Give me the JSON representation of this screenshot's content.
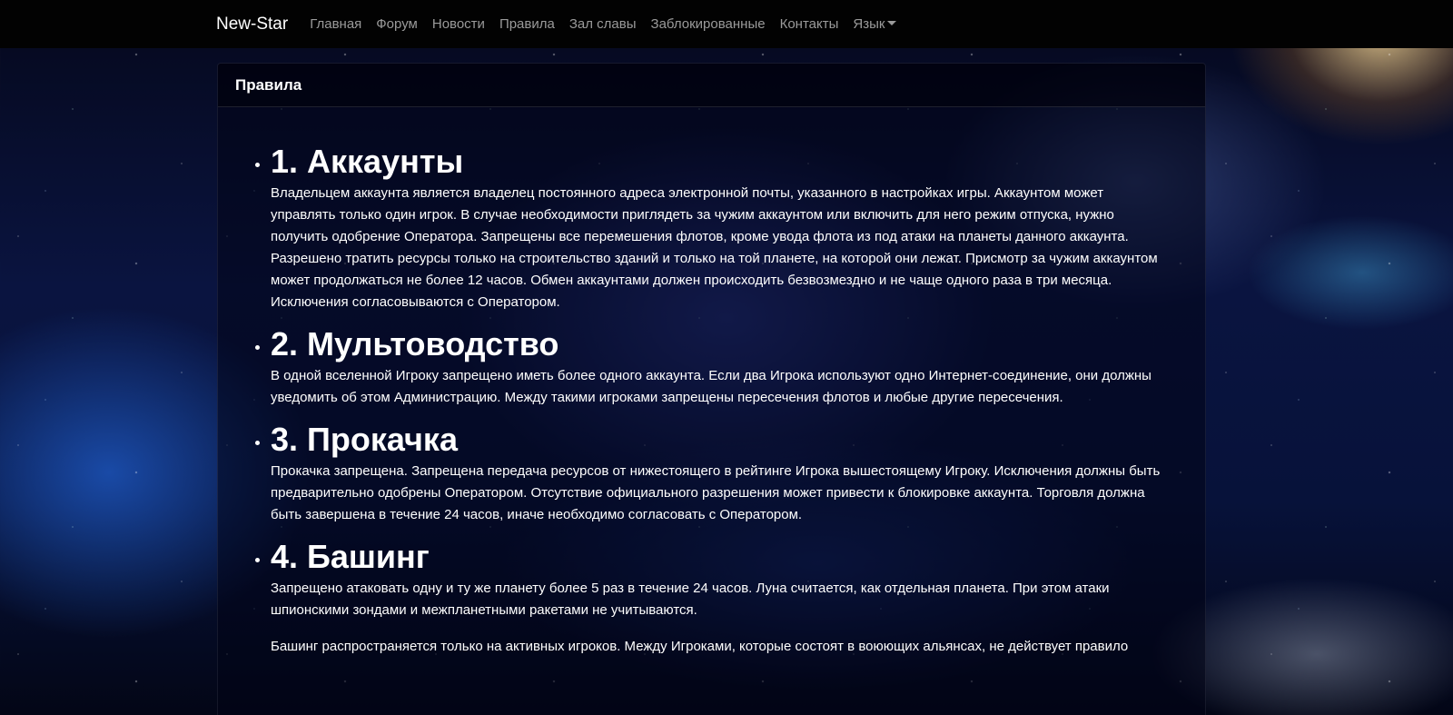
{
  "navbar": {
    "brand": "New-Star",
    "links": [
      "Главная",
      "Форум",
      "Новости",
      "Правила",
      "Зал славы",
      "Заблокированные",
      "Контакты"
    ],
    "language_label": "Язык"
  },
  "card": {
    "title": "Правила"
  },
  "rules": [
    {
      "title": "1. Аккаунты",
      "paragraphs": [
        "Владельцем аккаунта является владелец постоянного адреса электронной почты, указанного в настройках игры. Аккаунтом может управлять только один игрок. В случае необходимости приглядеть за чужим аккаунтом или включить для него режим отпуска, нужно получить одобрение Оператора. Запрещены все перемешения флотов, кроме увода флота из под атаки на планеты данного аккаунта. Разрешено тратить ресурсы только на строительство зданий и только на той планете, на которой они лежат. Присмотр за чужим аккаунтом может продолжаться не более 12 часов. Обмен аккаунтами должен происходить безвозмездно и не чаще одного раза в три месяца. Исключения согласовываются с Оператором."
      ]
    },
    {
      "title": "2. Мультоводство",
      "paragraphs": [
        "В одной вселенной Игроку запрещено иметь более одного аккаунта. Если два Игрока используют одно Интернет-соединение, они должны уведомить об этом Администрацию. Между такими игроками запрещены пересечения флотов и любые другие пересечения."
      ]
    },
    {
      "title": "3. Прокачка",
      "paragraphs": [
        "Прокачка запрещена. Запрещена передача ресурсов от нижестоящего в рейтинге Игрока вышестоящему Игроку. Исключения должны быть предварительно одобрены Оператором. Отсутствие официального разрешения может привести к блокировке аккаунта. Торговля должна быть завершена в течение 24 часов, иначе необходимо согласовать с Оператором."
      ]
    },
    {
      "title": "4. Башинг",
      "paragraphs": [
        "Запрещено атаковать одну и ту же планету более 5 раз в течение 24 часов. Луна считается, как отдельная планета. При этом атаки шпионскими зондами и межпланетными ракетами не учитываются.",
        "Башинг распространяется только на активных игроков. Между Игроками, которые состоят в воюющих альянсах, не действует правило"
      ]
    }
  ]
}
